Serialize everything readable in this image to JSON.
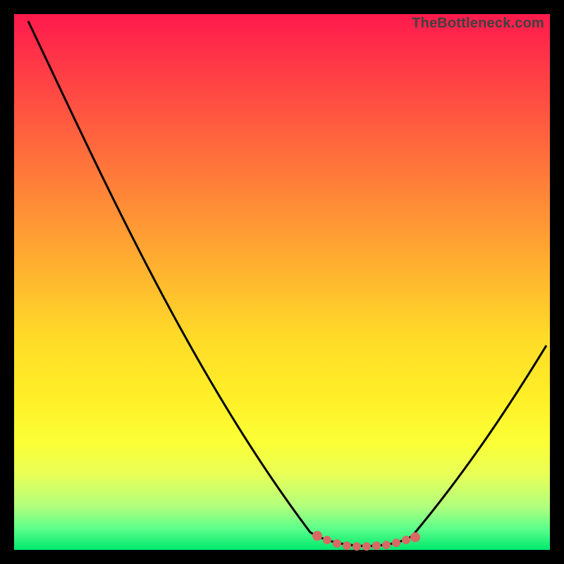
{
  "chart_data": {
    "type": "line",
    "watermark": "TheBottleneck.com",
    "title": "",
    "xlabel": "",
    "ylabel": "",
    "xlim": [
      0,
      100
    ],
    "ylim": [
      0,
      100
    ],
    "grid": false,
    "legend": false,
    "background_gradient_top": "#ff1a4d",
    "background_gradient_mid": "#ffda28",
    "background_gradient_bottom": "#00e86e",
    "series": [
      {
        "name": "bottleneck-curve",
        "color": "#000000",
        "x": [
          3,
          10,
          20,
          30,
          40,
          50,
          55,
          60,
          65,
          70,
          75,
          80,
          85,
          90,
          95,
          100
        ],
        "y": [
          99,
          85,
          67,
          50,
          33,
          15,
          6,
          2,
          1,
          0,
          1,
          5,
          15,
          26,
          33,
          38
        ]
      }
    ],
    "highlight": {
      "name": "optimal-range",
      "color": "#d86a64",
      "x": [
        56,
        58,
        60,
        62,
        64,
        66,
        68,
        70,
        72,
        74,
        76
      ],
      "y": [
        3,
        2,
        2,
        1,
        1,
        0,
        1,
        1,
        2,
        2,
        3
      ]
    }
  }
}
